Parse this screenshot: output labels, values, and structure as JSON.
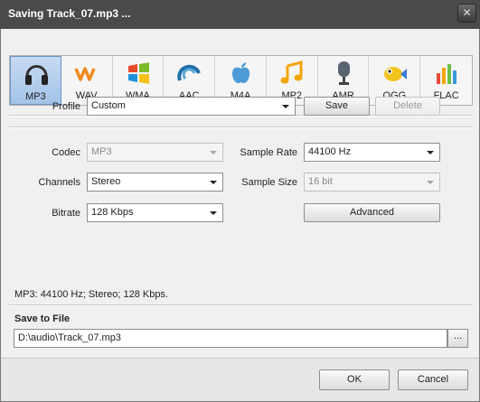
{
  "window": {
    "title": "Saving Track_07.mp3 ..."
  },
  "formats": [
    {
      "label": "MP3",
      "icon": "headphones-icon",
      "active": true
    },
    {
      "label": "WAV",
      "icon": "wav-wave-icon",
      "active": false
    },
    {
      "label": "WMA",
      "icon": "windows-logo-icon",
      "active": false
    },
    {
      "label": "AAC",
      "icon": "aac-swirl-icon",
      "active": false
    },
    {
      "label": "M4A",
      "icon": "apple-logo-icon",
      "active": false
    },
    {
      "label": "MP2",
      "icon": "music-note-icon",
      "active": false
    },
    {
      "label": "AMR",
      "icon": "microphone-icon",
      "active": false
    },
    {
      "label": "OGG",
      "icon": "fish-icon",
      "active": false
    },
    {
      "label": "FLAC",
      "icon": "equalizer-icon",
      "active": false
    }
  ],
  "profile": {
    "label": "Profile",
    "value": "Custom",
    "save_label": "Save",
    "delete_label": "Delete"
  },
  "settings": {
    "codec": {
      "label": "Codec",
      "value": "MP3"
    },
    "channels": {
      "label": "Channels",
      "value": "Stereo"
    },
    "bitrate": {
      "label": "Bitrate",
      "value": "128 Kbps"
    },
    "sample_rate": {
      "label": "Sample Rate",
      "value": "44100 Hz"
    },
    "sample_size": {
      "label": "Sample Size",
      "value": "16 bit"
    },
    "advanced_label": "Advanced"
  },
  "summary": "MP3: 44100  Hz; Stereo; 128 Kbps.",
  "save_to_file": {
    "title": "Save to File",
    "path": "D:\\audio\\Track_07.mp3",
    "browse_label": "..."
  },
  "buttons": {
    "ok": "OK",
    "cancel": "Cancel"
  },
  "colors": {
    "titlebar": "#4a4a4a",
    "active_tab": "#a3c3e8",
    "dialog_bg": "#f0f0f0"
  }
}
